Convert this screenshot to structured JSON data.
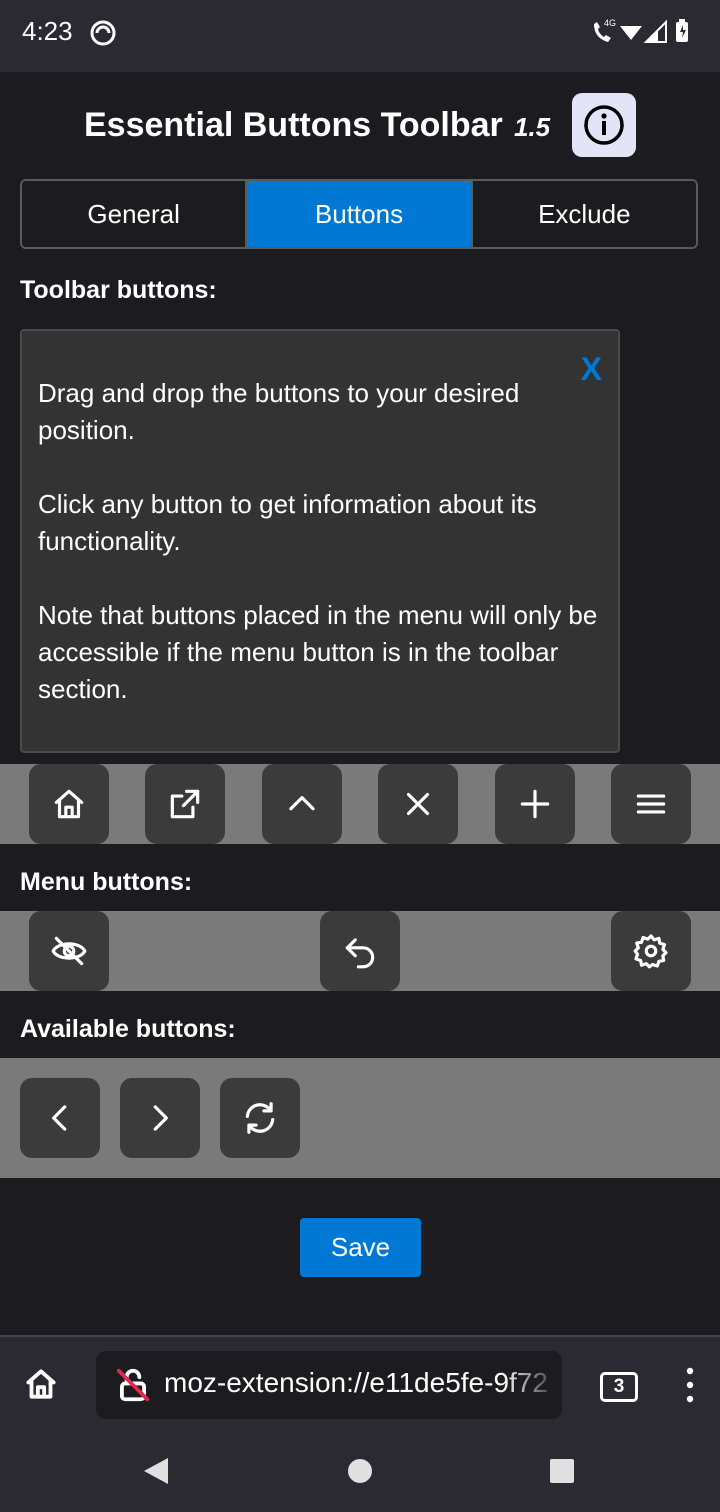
{
  "status_bar": {
    "time": "4:23",
    "network_label": "4G",
    "icons": [
      "do-not-disturb-icon",
      "call-icon",
      "wifi-icon",
      "signal-icon",
      "battery-charging-icon"
    ]
  },
  "header": {
    "title": "Essential Buttons Toolbar",
    "version": "1.5",
    "info_icon": "info-icon"
  },
  "tabs": [
    {
      "label": "General",
      "active": false
    },
    {
      "label": "Buttons",
      "active": true
    },
    {
      "label": "Exclude",
      "active": false
    }
  ],
  "toolbar_section": {
    "label": "Toolbar buttons:",
    "info_box": {
      "close_label": "X",
      "paragraphs": [
        "Drag and drop the buttons to your desired position.",
        "Click any button to get information about its functionality.",
        "Note that buttons placed in the menu will only be accessible if the menu button is in the toolbar section."
      ]
    },
    "buttons": [
      "home-icon",
      "open-external-icon",
      "chevron-up-icon",
      "close-icon",
      "plus-icon",
      "menu-icon"
    ]
  },
  "menu_section": {
    "label": "Menu buttons:",
    "buttons": [
      "eye-off-icon",
      "undo-icon",
      "gear-icon"
    ]
  },
  "available_section": {
    "label": "Available buttons:",
    "buttons": [
      "chevron-left-icon",
      "chevron-right-icon",
      "refresh-icon"
    ]
  },
  "save_label": "Save",
  "browser": {
    "url": "moz-extension://e11de5fe-9f72",
    "tab_count": "3",
    "icons": [
      "home-icon",
      "insecure-lock-icon",
      "overflow-menu-icon"
    ]
  },
  "colors": {
    "accent": "#0078d4",
    "background": "#1c1b1f",
    "strip": "#7a7a7a",
    "button": "#3b3b3b"
  }
}
